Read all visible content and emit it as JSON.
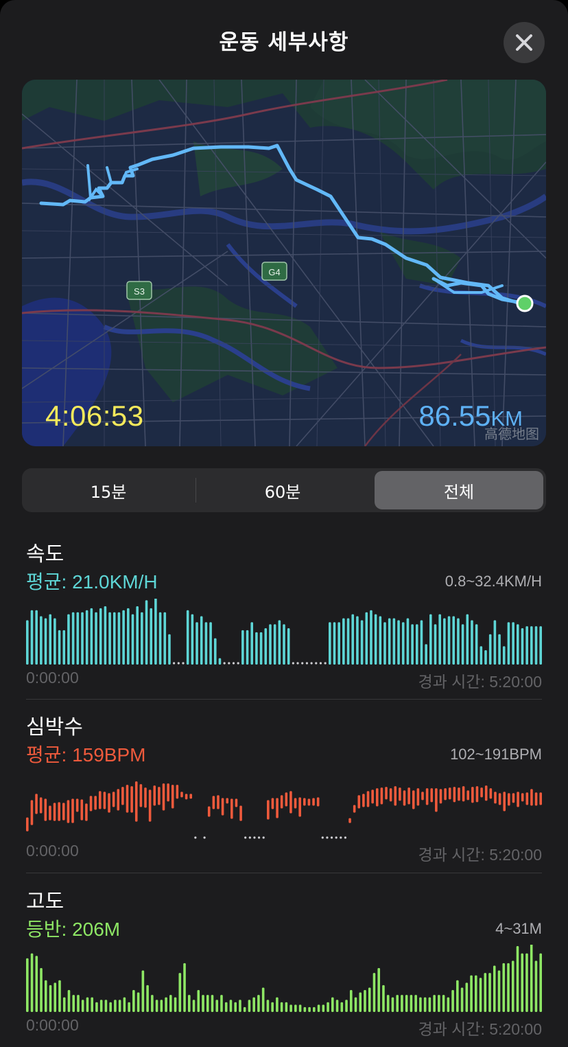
{
  "header": {
    "title": "운동 세부사항",
    "close_icon": "close-icon"
  },
  "map": {
    "duration": "4:06:53",
    "distance_value": "86.55",
    "distance_unit": "KM",
    "watermark": "高德地图",
    "road_shields": [
      "S3",
      "G4"
    ]
  },
  "segmented": {
    "options": [
      "15분",
      "60분",
      "전체"
    ],
    "selected": "전체"
  },
  "sections": {
    "speed": {
      "label": "속도",
      "stat": "평균: 21.0KM/H",
      "range": "0.8~32.4KM/H",
      "start_time": "0:00:00",
      "end_time": "경과 시간: 5:20:00",
      "color": "#5ed6d6"
    },
    "heart": {
      "label": "심박수",
      "stat": "평균: 159BPM",
      "range": "102~191BPM",
      "start_time": "0:00:00",
      "end_time": "경과 시간: 5:20:00",
      "color": "#ef5a3c"
    },
    "elevation": {
      "label": "고도",
      "stat": "등반: 206M",
      "range": "4~31M",
      "start_time": "0:00:00",
      "end_time": "경과 시간: 5:20:00",
      "color": "#8ee765"
    }
  },
  "chart_data": [
    {
      "type": "bar",
      "title": "속도",
      "ylabel": "",
      "ylim": [
        0.8,
        32.4
      ],
      "values": [
        23,
        28,
        28,
        25,
        24,
        26,
        24,
        18,
        18,
        26,
        27,
        27,
        27,
        28,
        29,
        27,
        29,
        30,
        27,
        27,
        27,
        28,
        29,
        26,
        30,
        27,
        33,
        29,
        35,
        27,
        27,
        16,
        0,
        1,
        0,
        28,
        26,
        22,
        25,
        22,
        22,
        14,
        4,
        0,
        0,
        0,
        0,
        18,
        18,
        22,
        17,
        17,
        19,
        21,
        21,
        23,
        21,
        19,
        0,
        0,
        0,
        0,
        0,
        0,
        0,
        0,
        22,
        22,
        22,
        24,
        24,
        26,
        25,
        23,
        27,
        28,
        26,
        25,
        22,
        24,
        24,
        23,
        22,
        24,
        21,
        21,
        23,
        11,
        26,
        21,
        26,
        24,
        25,
        25,
        24,
        21,
        26,
        23,
        21,
        10,
        8,
        16,
        23,
        16,
        10,
        22,
        22,
        21,
        19,
        20,
        20,
        20,
        20
      ]
    },
    {
      "type": "bar",
      "title": "심박수",
      "ylabel": "",
      "ylim": [
        102,
        191
      ],
      "values": [
        [
          113,
          133
        ],
        [
          122,
          158
        ],
        [
          138,
          167
        ],
        [
          139,
          162
        ],
        [
          128,
          160
        ],
        [
          129,
          150
        ],
        [
          128,
          154
        ],
        [
          128,
          155
        ],
        [
          129,
          154
        ],
        [
          125,
          158
        ],
        [
          125,
          160
        ],
        [
          141,
          160
        ],
        [
          129,
          159
        ],
        [
          128,
          153
        ],
        [
          142,
          164
        ],
        [
          144,
          164
        ],
        [
          145,
          171
        ],
        [
          145,
          170
        ],
        [
          140,
          168
        ],
        [
          148,
          170
        ],
        [
          143,
          174
        ],
        [
          151,
          177
        ],
        [
          140,
          180
        ],
        [
          140,
          178
        ],
        [
          127,
          185
        ],
        [
          148,
          181
        ],
        [
          147,
          176
        ],
        [
          127,
          173
        ],
        [
          150,
          179
        ],
        [
          151,
          177
        ],
        [
          143,
          182
        ],
        [
          156,
          182
        ],
        [
          146,
          180
        ],
        [
          160,
          180
        ],
        [
          162,
          170
        ],
        [
          159,
          167
        ],
        [
          160,
          167
        ],
        [
          0,
          0
        ],
        [
          95,
          95
        ],
        [
          0,
          0
        ],
        [
          134,
          149
        ],
        [
          145,
          164
        ],
        [
          145,
          165
        ],
        [
          136,
          161
        ],
        [
          153,
          161
        ],
        [
          131,
          160
        ],
        [
          148,
          160
        ],
        [
          128,
          150
        ],
        [
          0,
          0
        ],
        [
          0,
          0
        ],
        [
          0,
          0
        ],
        [
          0,
          0
        ],
        [
          0,
          0
        ],
        [
          130,
          158
        ],
        [
          145,
          161
        ],
        [
          132,
          161
        ],
        [
          146,
          165
        ],
        [
          149,
          169
        ],
        [
          139,
          171
        ],
        [
          146,
          161
        ],
        [
          134,
          162
        ],
        [
          150,
          161
        ],
        [
          150,
          160
        ],
        [
          150,
          161
        ],
        [
          149,
          162
        ],
        [
          0,
          0
        ],
        [
          0,
          0
        ],
        [
          0,
          0
        ],
        [
          0,
          0
        ],
        [
          0,
          0
        ],
        [
          0,
          0
        ],
        [
          125,
          132
        ],
        [
          140,
          151
        ],
        [
          146,
          165
        ],
        [
          148,
          167
        ],
        [
          148,
          171
        ],
        [
          153,
          173
        ],
        [
          149,
          175
        ],
        [
          152,
          176
        ],
        [
          159,
          177
        ],
        [
          156,
          175
        ],
        [
          150,
          178
        ],
        [
          157,
          176
        ],
        [
          150,
          172
        ],
        [
          152,
          176
        ],
        [
          145,
          172
        ],
        [
          150,
          175
        ],
        [
          158,
          170
        ],
        [
          151,
          175
        ],
        [
          155,
          175
        ],
        [
          141,
          175
        ],
        [
          153,
          174
        ],
        [
          158,
          175
        ],
        [
          159,
          176
        ],
        [
          155,
          177
        ],
        [
          157,
          176
        ],
        [
          156,
          178
        ],
        [
          158,
          172
        ],
        [
          154,
          177
        ],
        [
          155,
          178
        ],
        [
          162,
          176
        ],
        [
          157,
          179
        ],
        [
          160,
          175
        ],
        [
          153,
          170
        ],
        [
          151,
          168
        ],
        [
          142,
          170
        ],
        [
          150,
          168
        ],
        [
          154,
          168
        ],
        [
          148,
          170
        ],
        [
          156,
          168
        ],
        [
          151,
          169
        ],
        [
          150,
          174
        ],
        [
          150,
          169
        ],
        [
          151,
          169
        ]
      ]
    },
    {
      "type": "bar",
      "title": "고도",
      "ylabel": "",
      "ylim": [
        4,
        31
      ],
      "values": [
        26,
        28,
        27,
        22,
        17,
        15,
        16,
        17,
        10,
        13,
        11,
        11,
        9,
        10,
        10,
        8,
        9,
        9,
        8,
        9,
        9,
        10,
        8,
        13,
        12,
        21,
        15,
        11,
        9,
        9,
        10,
        11,
        10,
        20,
        24,
        11,
        9,
        13,
        11,
        11,
        11,
        9,
        11,
        8,
        9,
        8,
        9,
        6,
        9,
        10,
        11,
        14,
        9,
        8,
        10,
        8,
        8,
        7,
        7,
        7,
        6,
        6,
        6,
        7,
        7,
        8,
        10,
        9,
        8,
        9,
        13,
        10,
        12,
        13,
        14,
        20,
        22,
        15,
        11,
        10,
        11,
        11,
        11,
        11,
        11,
        10,
        10,
        10,
        11,
        11,
        11,
        10,
        13,
        17,
        14,
        16,
        19,
        19,
        18,
        20,
        20,
        23,
        21,
        24,
        24,
        25,
        31,
        28,
        28,
        32,
        25,
        28
      ]
    }
  ]
}
